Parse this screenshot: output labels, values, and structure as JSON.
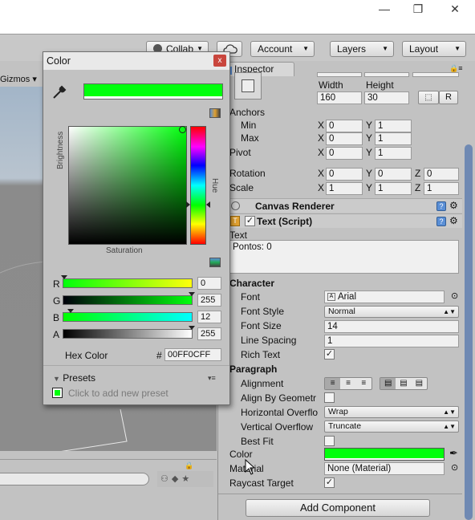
{
  "window": {
    "minimize": "—",
    "maximize": "❐",
    "close": "✕"
  },
  "toolbar": {
    "collab": "Collab",
    "cloud_icon": "cloud-icon",
    "account": "Account",
    "layers": "Layers",
    "layout": "Layout"
  },
  "scene": {
    "gizmos": "Gizmos"
  },
  "inspector": {
    "tab": "Inspector",
    "rect": {
      "width_label": "Width",
      "height_label": "Height",
      "width": "160",
      "height": "30",
      "r_button": "R",
      "anchors": "Anchors",
      "min": "Min",
      "max": "Max",
      "min_x": "0",
      "min_y": "1",
      "max_x": "0",
      "max_y": "1",
      "pivot": "Pivot",
      "pivot_x": "0",
      "pivot_y": "1",
      "rotation": "Rotation",
      "rot_x": "0",
      "rot_y": "0",
      "rot_z": "0",
      "scale": "Scale",
      "scale_x": "1",
      "scale_y": "1",
      "scale_z": "1",
      "x": "X",
      "y": "Y",
      "z": "Z"
    },
    "canvas_renderer": "Canvas Renderer",
    "text_script": "Text (Script)",
    "text_label": "Text",
    "text_value": "Pontos: 0",
    "character": "Character",
    "font_label": "Font",
    "font_value": "Arial",
    "font_style_label": "Font Style",
    "font_style_value": "Normal",
    "font_size_label": "Font Size",
    "font_size_value": "14",
    "line_spacing_label": "Line Spacing",
    "line_spacing_value": "1",
    "rich_text_label": "Rich Text",
    "paragraph": "Paragraph",
    "alignment_label": "Alignment",
    "align_by_geometry_label": "Align By Geometr",
    "horizontal_overflow_label": "Horizontal Overflo",
    "horizontal_overflow_value": "Wrap",
    "vertical_overflow_label": "Vertical Overflow",
    "vertical_overflow_value": "Truncate",
    "best_fit_label": "Best Fit",
    "color_label": "Color",
    "material_label": "Material",
    "material_value": "None (Material)",
    "raycast_label": "Raycast Target",
    "add_component": "Add Component",
    "check": "✓"
  },
  "color_picker": {
    "title": "Color",
    "close": "x",
    "brightness": "Brightness",
    "saturation": "Saturation",
    "hue": "Hue",
    "r_label": "R",
    "g_label": "G",
    "b_label": "B",
    "a_label": "A",
    "r": "0",
    "g": "255",
    "b": "12",
    "a": "255",
    "hex_label": "Hex Color",
    "hash": "#",
    "hex": "00FF0CFF",
    "presets": "Presets",
    "add_preset": "Click to add new preset",
    "colors": {
      "current": "#00ff0c",
      "accent": "#00c800"
    }
  }
}
